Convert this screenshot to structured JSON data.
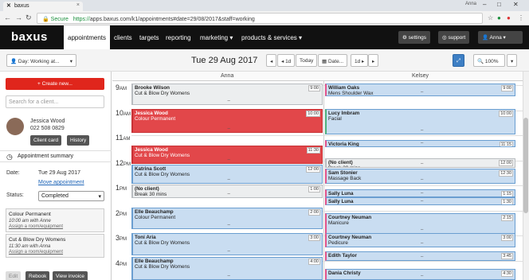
{
  "browser": {
    "tab_title": "baxus",
    "window_user": "Anna",
    "secure_label": "Secure",
    "url_scheme": "https://",
    "url_rest": "apps.baxus.com/k1/appointments#date=29/08/2017&staff=working"
  },
  "nav": {
    "logo": "baxus",
    "items": [
      "appointments",
      "clients",
      "targets",
      "reporting",
      "marketing ▾",
      "products & services ▾"
    ],
    "settings": "settings",
    "support": "support",
    "user": "Anna ▾"
  },
  "toolbar": {
    "view_select": "Day: Working at...",
    "date_title": "Tue 29 Aug 2017",
    "prev_day": "◂ 1d",
    "today": "Today",
    "date_btn": "Date...",
    "next_day": "1d ▸",
    "zoom": "100%"
  },
  "left": {
    "create": "+ Create new...",
    "search_placeholder": "Search for a client...",
    "client_name": "Jessica Wood",
    "client_phone": "022 508 0829",
    "client_card": "Client card",
    "history": "History",
    "summary_title": "Appointment summary",
    "date_label": "Date:",
    "date_value": "Tue 29 Aug 2017",
    "move_link": "Move appointment",
    "status_label": "Status:",
    "status_value": "Completed",
    "services": [
      {
        "title": "Colour Permanent",
        "when": "10:00 am with Anne",
        "assign": "Assign a room/equipment"
      },
      {
        "title": "Cut & Blow Dry Womens",
        "when": "11:30 am with Anna",
        "assign": "Assign a room/equipment"
      }
    ],
    "edit": "Edit",
    "rebook": "Rebook",
    "view_invoice": "View invoice"
  },
  "calendar": {
    "staff": [
      "Anna",
      "Kelsey"
    ],
    "hours": [
      {
        "h": "9",
        "ap": "AM"
      },
      {
        "h": "10",
        "ap": "AM"
      },
      {
        "h": "11",
        "ap": "AM"
      },
      {
        "h": "12",
        "ap": "PM"
      },
      {
        "h": "1",
        "ap": "PM"
      },
      {
        "h": "2",
        "ap": "PM"
      },
      {
        "h": "3",
        "ap": "PM"
      },
      {
        "h": "4",
        "ap": "PM"
      }
    ],
    "anna": [
      {
        "name": "Brooke Wilson",
        "svc": "Cut & Blow Dry Womens",
        "time": "9:00",
        "style": "grey"
      },
      {
        "name": "Jessica Wood",
        "svc": "Colour Permanent",
        "time": "10:00",
        "style": "red"
      },
      {
        "name": "Jessica Wood",
        "svc": "Cut & Blow Dry Womens",
        "time": "11:30",
        "style": "red"
      },
      {
        "name": "Katrina Scott",
        "svc": "Cut & Blow Dry Womens",
        "time": "12:00",
        "style": "blue"
      },
      {
        "name": "(No client)",
        "svc": "Break 30 mins",
        "time": "1:00",
        "style": "grey"
      },
      {
        "name": "Elle Beauchamp",
        "svc": "Colour Permanent",
        "time": "2:00",
        "style": "blue"
      },
      {
        "name": "Toni Aria",
        "svc": "Cut & Blow Dry Womens",
        "time": "3:00",
        "style": "blue"
      },
      {
        "name": "Elle Beauchamp",
        "svc": "Cut & Blow Dry Womens",
        "time": "4:00",
        "style": "blue"
      }
    ],
    "kelsey": [
      {
        "name": "William Oaks",
        "svc": "Mens Shoulder Wax",
        "time": "9:00",
        "style": "pink"
      },
      {
        "name": "Lucy Imbram",
        "svc": "Facial",
        "time": "10:00",
        "style": "green"
      },
      {
        "name": "Victoria King",
        "svc": "",
        "time": "11:15",
        "style": "pink"
      },
      {
        "name": "(No client)",
        "svc": "Break 30 mins",
        "time": "12:00",
        "style": "grey"
      },
      {
        "name": "Sam Stonier",
        "svc": "Massage Back",
        "time": "12:30",
        "style": "pink"
      },
      {
        "name": "Sally Luna",
        "svc": "",
        "time": "1:15",
        "style": "pink"
      },
      {
        "name": "Sally Luna",
        "svc": "Eyelash Tint",
        "time": "1:30",
        "style": "pink"
      },
      {
        "name": "Courtney Neuman",
        "svc": "Manicure",
        "time": "2:15",
        "style": "pink"
      },
      {
        "name": "Courtney Neuman",
        "svc": "Pedicure",
        "time": "3:00",
        "style": "pink"
      },
      {
        "name": "Edith Taylor",
        "svc": "",
        "time": "3:45",
        "style": "pink"
      },
      {
        "name": "Dania Christy",
        "svc": "",
        "time": "4:30",
        "style": "pink"
      }
    ]
  }
}
